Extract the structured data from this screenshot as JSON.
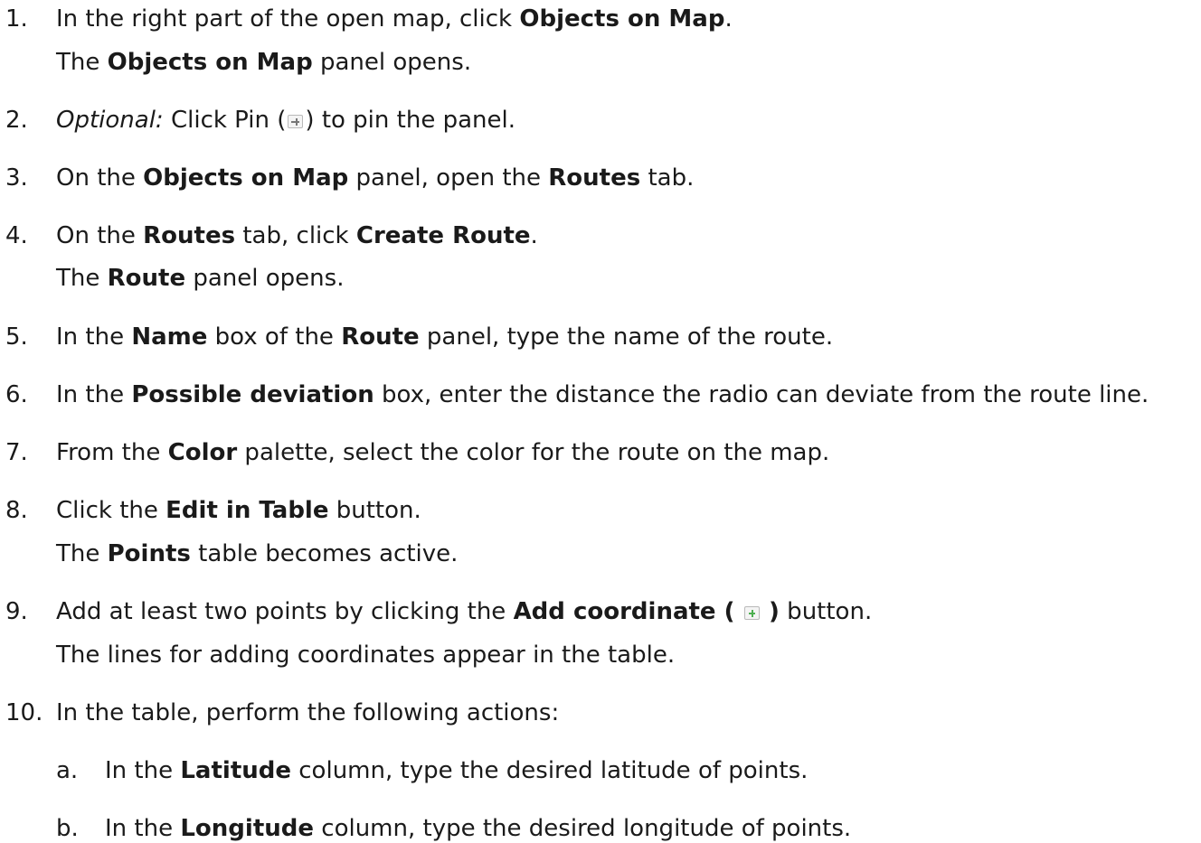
{
  "steps": [
    {
      "num": "1.",
      "parts": [
        "In the right part of the open map, click ",
        "Objects on Map",
        "."
      ],
      "result": [
        "The ",
        "Objects on Map",
        " panel opens."
      ]
    },
    {
      "num": "2.",
      "parts": [
        "Optional:",
        " Click Pin (",
        ") to pin the panel."
      ]
    },
    {
      "num": "3.",
      "parts": [
        "On the ",
        "Objects on Map",
        " panel, open the ",
        "Routes",
        " tab."
      ]
    },
    {
      "num": "4.",
      "parts": [
        "On the ",
        "Routes",
        " tab, click ",
        "Create Route",
        "."
      ],
      "result": [
        "The ",
        "Route",
        " panel opens."
      ]
    },
    {
      "num": "5.",
      "parts": [
        "In the ",
        "Name",
        " box of the ",
        "Route",
        " panel, type the name of the route."
      ]
    },
    {
      "num": "6.",
      "parts": [
        "In the ",
        "Possible deviation",
        " box, enter the distance the radio can deviate from the route line."
      ]
    },
    {
      "num": "7.",
      "parts": [
        "From the ",
        "Color",
        " palette, select the color for the route on the map."
      ]
    },
    {
      "num": "8.",
      "parts": [
        "Click the ",
        "Edit in Table",
        " button."
      ],
      "result": [
        "The ",
        "Points",
        " table becomes active."
      ]
    },
    {
      "num": "9.",
      "parts": [
        "Add at least two points by clicking the ",
        "Add coordinate (",
        ")",
        " button."
      ],
      "result": [
        "The lines for adding coordinates appear in the table."
      ]
    },
    {
      "num": "10.",
      "parts": [
        "In the table, perform the following actions:"
      ]
    }
  ],
  "substeps": [
    {
      "num": "a.",
      "parts": [
        "In the ",
        "Latitude",
        " column, type the desired latitude of points."
      ]
    },
    {
      "num": "b.",
      "parts": [
        "In the ",
        "Longitude",
        " column, type the desired longitude of points."
      ]
    }
  ],
  "icons": {
    "pin": "pin-icon",
    "add": "add-coordinate-icon"
  }
}
